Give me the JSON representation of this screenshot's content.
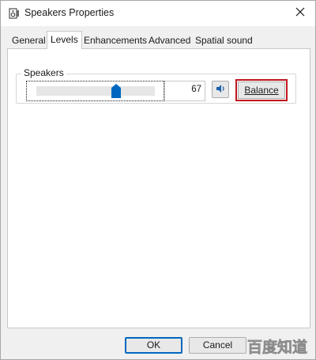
{
  "window": {
    "title": "Speakers Properties",
    "icons": {
      "app": "speaker-properties-icon",
      "close": "close-icon"
    }
  },
  "tabs": [
    {
      "label": "General",
      "active": false
    },
    {
      "label": "Levels",
      "active": true
    },
    {
      "label": "Enhancements",
      "active": false
    },
    {
      "label": "Advanced",
      "active": false
    },
    {
      "label": "Spatial sound",
      "active": false
    }
  ],
  "levels": {
    "group_label": "Speakers",
    "volume_value": "67",
    "volume_level": 0.67,
    "mute_icon": "speaker-volume-icon",
    "balance_label": "Balance",
    "highlight_color": "#c0161e"
  },
  "footer": {
    "ok_label": "OK",
    "cancel_label": "Cancel"
  },
  "watermark": {
    "text": "百度知道",
    "color": "#e0e0e0"
  },
  "colors": {
    "accent": "#0067c0",
    "slider_thumb": "#0067c0"
  }
}
